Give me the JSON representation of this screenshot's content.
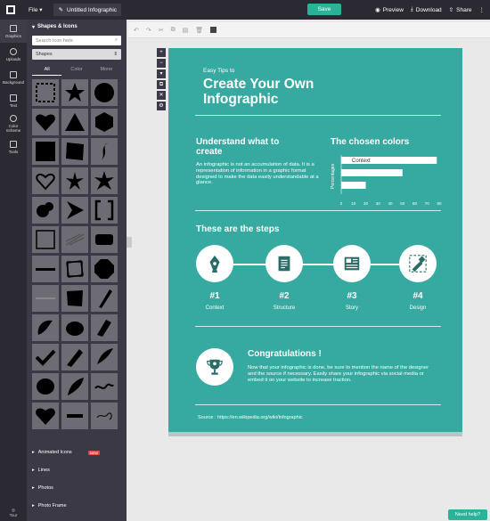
{
  "topbar": {
    "file_label": "File",
    "doc_title": "Untitled Infographic",
    "save_label": "Save",
    "preview_label": "Preview",
    "download_label": "Download",
    "share_label": "Share"
  },
  "rail": {
    "items": [
      {
        "label": "Graphics",
        "icon": "graphics-icon"
      },
      {
        "label": "Uploads",
        "icon": "cloud-upload-icon"
      },
      {
        "label": "Background",
        "icon": "background-icon"
      },
      {
        "label": "Text",
        "icon": "text-icon"
      },
      {
        "label": "Color Scheme",
        "icon": "palette-icon"
      },
      {
        "label": "Tools",
        "icon": "tools-icon"
      }
    ],
    "tour_label": "Tour"
  },
  "panel": {
    "section_title": "Shapes & Icons",
    "search_placeholder": "Search Icon here",
    "select_value": "Shapes",
    "tabs": [
      "All",
      "Color",
      "Mono"
    ],
    "sections": [
      {
        "label": "Animated Icons",
        "badge": "NEW"
      },
      {
        "label": "Lines"
      },
      {
        "label": "Photos"
      },
      {
        "label": "Photo Frame"
      }
    ]
  },
  "canvas": {
    "subtitle": "Easy Tips to",
    "title": "Create Your Own Infographic",
    "understand_heading": "Understand what to create",
    "understand_text": "An infographic is not an accumulation of data. It is a representation of information in a graphic format designed to make the data easily understandable at a glance.",
    "colors_heading": "The chosen colors",
    "steps_heading": "These are the steps",
    "steps": [
      {
        "num": "#1",
        "label": "Context"
      },
      {
        "num": "#2",
        "label": "Structure"
      },
      {
        "num": "#3",
        "label": "Story"
      },
      {
        "num": "#4",
        "label": "Design"
      }
    ],
    "congrats_heading": "Congratulations !",
    "congrats_text": "Now that your infographic is done, be sure to mention the name of the designer and the source if necessary. Easily share your infographic via social media or embed it on your website to increase traction.",
    "source": "Source : https://en.wikipedia.org/wiki/Infographic"
  },
  "chart_data": {
    "type": "bar",
    "orientation": "horizontal",
    "categories": [
      "Context",
      "",
      ""
    ],
    "values": [
      78,
      50,
      20
    ],
    "ylabel": "Percentages",
    "xlim": [
      0,
      80
    ],
    "xticks": [
      "0",
      "10",
      "20",
      "30",
      "40",
      "50",
      "60",
      "70",
      "80"
    ]
  },
  "help_label": "Need help?"
}
